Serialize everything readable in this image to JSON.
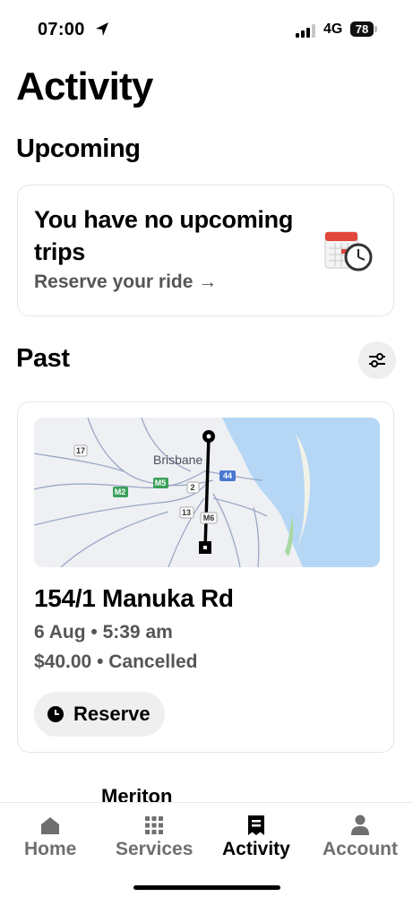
{
  "status_bar": {
    "time": "07:00",
    "network": "4G",
    "battery": "78"
  },
  "page_title": "Activity",
  "upcoming": {
    "section_title": "Upcoming",
    "heading": "You have no upcoming trips",
    "link_label": "Reserve your ride →",
    "icon": "calendar-clock-icon"
  },
  "past": {
    "section_title": "Past",
    "filter_icon": "filter-sliders-icon",
    "trip": {
      "map": {
        "city_label": "Brisbane",
        "road_shields": [
          "17",
          "M2",
          "M5",
          "2",
          "44",
          "13",
          "M6"
        ]
      },
      "title": "154/1 Manuka Rd",
      "datetime": "6 Aug • 5:39 am",
      "fare_status": "$40.00 • Cancelled",
      "reserve_label": "Reserve"
    },
    "next_item_partial": "Meriton"
  },
  "tab_bar": {
    "tabs": [
      {
        "label": "Home",
        "icon": "home-icon",
        "active": false
      },
      {
        "label": "Services",
        "icon": "grid-icon",
        "active": false
      },
      {
        "label": "Activity",
        "icon": "receipt-icon",
        "active": true
      },
      {
        "label": "Account",
        "icon": "person-icon",
        "active": false
      }
    ]
  },
  "colors": {
    "accent": "#000000",
    "secondary_text": "#555555",
    "map_water": "#b5d7f5",
    "map_land": "#eef0f4"
  }
}
